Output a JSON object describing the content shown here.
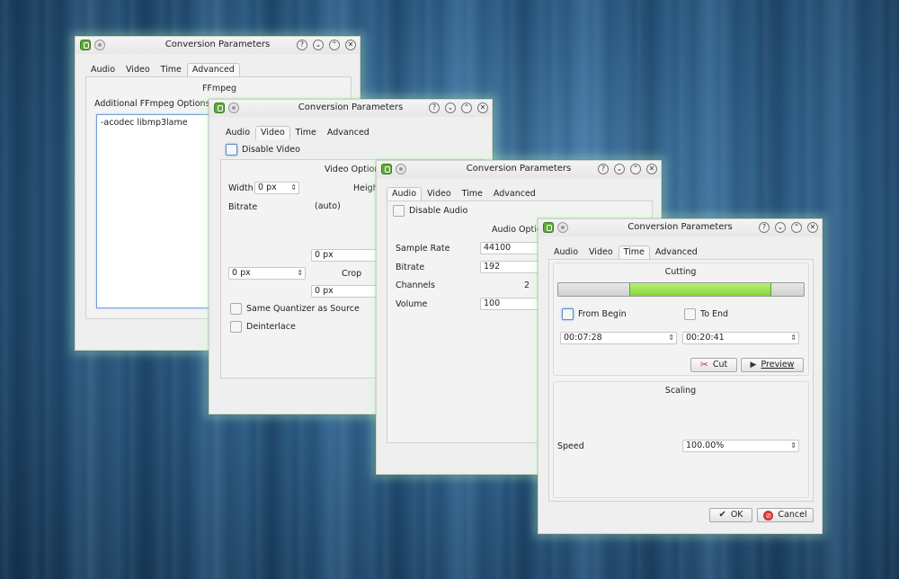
{
  "windows": {
    "advanced": {
      "title": "Conversion Parameters",
      "tabs": [
        "Audio",
        "Video",
        "Time",
        "Advanced"
      ],
      "group_title": "FFmpeg",
      "options_label": "Additional FFmpeg Options",
      "options_value": "-acodec libmp3lame"
    },
    "video": {
      "title": "Conversion Parameters",
      "tabs": [
        "Audio",
        "Video",
        "Time",
        "Advanced"
      ],
      "disable_label": "Disable Video",
      "group_title": "Video Options",
      "width_label": "Width",
      "width_value": "0 px",
      "height_label": "Height",
      "bitrate_label": "Bitrate",
      "bitrate_value": "(auto)",
      "crop_top": "0 px",
      "crop_left": "0 px",
      "crop_label": "Crop",
      "crop_bottom": "0 px",
      "same_quantizer_label": "Same Quantizer as Source",
      "deinterlace_label": "Deinterlace"
    },
    "audio": {
      "title": "Conversion Parameters",
      "tabs": [
        "Audio",
        "Video",
        "Time",
        "Advanced"
      ],
      "disable_label": "Disable Audio",
      "group_title": "Audio Options",
      "sample_rate_label": "Sample Rate",
      "sample_rate_value": "44100",
      "bitrate_label": "Bitrate",
      "bitrate_value": "192",
      "channels_label": "Channels",
      "channels_value": "2",
      "volume_label": "Volume",
      "volume_value": "100"
    },
    "time": {
      "title": "Conversion Parameters",
      "tabs": [
        "Audio",
        "Video",
        "Time",
        "Advanced"
      ],
      "cutting_title": "Cutting",
      "cut_range": {
        "start_fraction": 0.29,
        "end_fraction": 0.87
      },
      "from_begin_label": "From Begin",
      "to_end_label": "To End",
      "begin_time": "00:07:28",
      "end_time": "00:20:41",
      "cut_label": "Cut",
      "preview_label": "Preview",
      "scaling_title": "Scaling",
      "speed_label": "Speed",
      "speed_value": "100.00%",
      "ok_label": "OK",
      "cancel_label": "Cancel"
    }
  },
  "colors": {
    "accent_green": "#86d63c",
    "focus_blue": "#5a8bc9",
    "cancel_red": "#d63030"
  },
  "icons": {
    "titlebar": [
      "app-icon",
      "pin-icon",
      "help-icon",
      "minimize-icon",
      "maximize-icon",
      "close-icon"
    ],
    "buttons": [
      "scissors-icon",
      "play-icon",
      "check-icon",
      "cancel-icon"
    ]
  }
}
